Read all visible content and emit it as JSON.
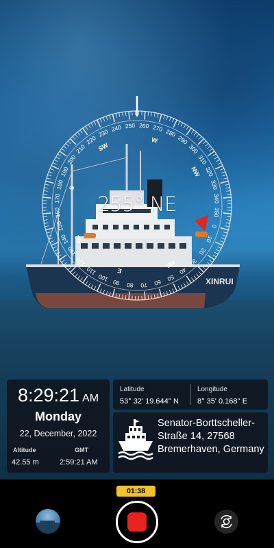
{
  "compass": {
    "heading": "255° NE",
    "degree_labels": [
      "260",
      "270",
      "280",
      "290",
      "300",
      "310",
      "320",
      "330",
      "340",
      "350",
      "0",
      "10",
      "20",
      "30",
      "40",
      "50",
      "60",
      "70",
      "80",
      "90",
      "100",
      "110",
      "120",
      "130",
      "140",
      "150",
      "160",
      "170",
      "180",
      "190",
      "200",
      "210",
      "220",
      "230",
      "240",
      "250"
    ],
    "cardinals": [
      "N",
      "NE",
      "E",
      "SE",
      "S",
      "SW",
      "W",
      "NW"
    ],
    "north_marker_color": "#e8221c"
  },
  "time_panel": {
    "time": "8:29:21",
    "ampm": "AM",
    "day": "Monday",
    "date": "22, December, 2022",
    "altitude_label": "Altitude",
    "altitude_value": "42.55 m",
    "gmt_label": "GMT",
    "gmt_value": "2:59:21 AM"
  },
  "coordinates": {
    "latitude_label": "Latitude",
    "latitude_value": "53° 32' 19.644'' N",
    "longitude_label": "Longitude",
    "longitude_value": "8° 35' 0.168'' E"
  },
  "address": {
    "icon": "ship-icon",
    "text": "Senator-Borttscheller-Straße 14, 27568 Bremerhaven, Germany"
  },
  "controls": {
    "recording_timer": "01:38",
    "timer_color": "#f2c12e",
    "record_color": "#e8221c",
    "gallery_icon": "gallery-thumbnail",
    "switch_icon": "switch-camera-icon"
  },
  "ship_name": "XINRUI"
}
